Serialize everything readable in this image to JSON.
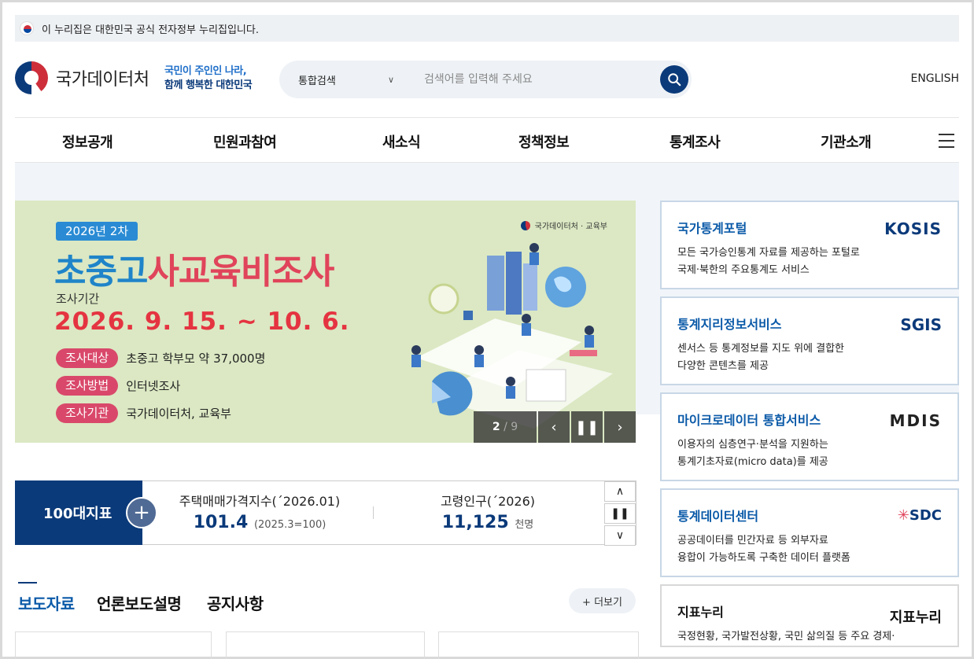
{
  "gov_bar": {
    "text": "이 누리집은 대한민국 공식 전자정부 누리집입니다."
  },
  "header": {
    "logo_text": "국가데이터처",
    "slogan_line1": "국민이 주인인 나라,",
    "slogan_line2": "함께 행복한 대한민국",
    "search_scope": "통합검색",
    "search_placeholder": "검색어를 입력해 주세요",
    "english": "ENGLISH"
  },
  "nav": [
    "정보공개",
    "민원과참여",
    "새소식",
    "정책정보",
    "통계조사",
    "기관소개"
  ],
  "banner": {
    "tag": "2026년 2차",
    "title_a": "초중고",
    "title_b": "사교육비조사",
    "sub": "조사기간",
    "date": "2026. 9. 15. ~ 10. 6.",
    "rows": [
      {
        "pill": "조사대상",
        "value": "초중고 학부모 약 37,000명"
      },
      {
        "pill": "조사방법",
        "value": "인터넷조사"
      },
      {
        "pill": "조사기관",
        "value": "국가데이터처, 교육부"
      }
    ],
    "org": "국가데이터처 · 교육부",
    "page_current": "2",
    "page_total": "/ 9"
  },
  "indicators": {
    "label": "100대지표",
    "items": [
      {
        "name": "주택매매가격지수(´2026.01)",
        "value": "101.4",
        "unit": "(2025.3=100)"
      },
      {
        "name": "고령인구(´2026)",
        "value": "11,125",
        "unit": "천명"
      }
    ]
  },
  "tabs": [
    "보도자료",
    "언론보도설명",
    "공지사항"
  ],
  "more": "+ 더보기",
  "services": [
    {
      "title": "국가통계포털",
      "desc1": "모든 국가승인통계 자료를 제공하는 포털로",
      "desc2": "국제·북한의 주요통계도 서비스",
      "logo": "KOSIS"
    },
    {
      "title": "통계지리정보서비스",
      "desc1": "센서스 등 통계정보를 지도 위에 결합한",
      "desc2": "다양한 콘텐츠를 제공",
      "logo": "SGIS"
    },
    {
      "title": "마이크로데이터 통합서비스",
      "desc1": "이용자의 심층연구·분석을 지원하는",
      "desc2": "통계기초자료(micro data)를 제공",
      "logo": "MDIS"
    },
    {
      "title": "통계데이터센터",
      "desc1": "공공데이터를 민간자료 등 외부자료",
      "desc2": "융합이 가능하도록 구축한 데이터 플랫폼",
      "logo": "SDC"
    },
    {
      "title": "지표누리",
      "desc1": "국정현황, 국가발전상황, 국민 삶의질 등 주요 경제·",
      "desc2": "",
      "logo": "지표누리"
    }
  ],
  "colors": {
    "navy": "#0b3a7a",
    "blue": "#1f84c9",
    "red": "#e53441",
    "pink": "#d9486a"
  }
}
